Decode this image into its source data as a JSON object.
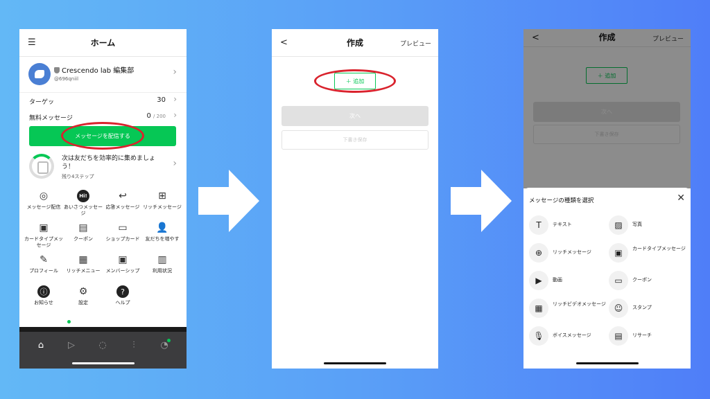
{
  "colors": {
    "line_green": "#06c755",
    "highlight_red": "#d9232d",
    "background_left": "#63b8f6",
    "background_right": "#4f7ef8"
  },
  "screen1": {
    "menu_icon": "☰",
    "title": "ホーム",
    "account": {
      "name": "Crescendo lab 編集部",
      "id": "@696qniil"
    },
    "target": {
      "label": "ターゲッ",
      "value": "30"
    },
    "free_messages": {
      "label": "無料メッセージ",
      "value": "0",
      "limit": "/ 200"
    },
    "send_button": "メッセージを配信する",
    "steps": {
      "text": "次は友だちを効率的に集めましょう！",
      "sub": "残り4ステップ"
    },
    "grid": [
      {
        "label": "メッセージ配信",
        "icon": "broadcast-icon",
        "glyph": "◎"
      },
      {
        "label": "あいさつメッセージ",
        "icon": "hi-bubble-icon",
        "glyph": "Hi!"
      },
      {
        "label": "応答メッセージ",
        "icon": "reply-icon",
        "glyph": "↩"
      },
      {
        "label": "リッチメッセージ",
        "icon": "rich-message-icon",
        "glyph": "⊞"
      },
      {
        "label": "カードタイプメッセージ",
        "icon": "card-type-icon",
        "glyph": "▣"
      },
      {
        "label": "クーポン",
        "icon": "coupon-icon",
        "glyph": "▤"
      },
      {
        "label": "ショップカード",
        "icon": "shop-card-icon",
        "glyph": "▭"
      },
      {
        "label": "友だちを増やす",
        "icon": "add-friend-icon",
        "glyph": "👤"
      },
      {
        "label": "プロフィール",
        "icon": "profile-icon",
        "glyph": "✎"
      },
      {
        "label": "リッチメニュー",
        "icon": "rich-menu-icon",
        "glyph": "▦"
      },
      {
        "label": "メンバーシップ",
        "icon": "membership-icon",
        "glyph": "▣"
      },
      {
        "label": "利用状況",
        "icon": "usage-icon",
        "glyph": "▥"
      },
      {
        "label": "お知らせ",
        "icon": "notice-icon",
        "glyph": "ⓘ"
      },
      {
        "label": "設定",
        "icon": "settings-icon",
        "glyph": "⚙"
      },
      {
        "label": "ヘルプ",
        "icon": "help-icon",
        "glyph": "?"
      }
    ],
    "tabs": [
      {
        "icon": "home-tab-icon",
        "glyph": "⌂"
      },
      {
        "icon": "play-tab-icon",
        "glyph": "▷"
      },
      {
        "icon": "chat-tab-icon",
        "glyph": "◌"
      },
      {
        "icon": "stats-tab-icon",
        "glyph": "⫶"
      },
      {
        "icon": "bell-tab-icon",
        "glyph": "◔"
      }
    ]
  },
  "screen2": {
    "back": "<",
    "title": "作成",
    "preview": "プレビュー",
    "add_button": "＋ 追加",
    "next_button": "次へ",
    "draft_button": "下書き保存"
  },
  "screen3": {
    "back": "<",
    "title": "作成",
    "preview": "プレビュー",
    "add_button": "＋ 追加",
    "next_button": "次へ",
    "draft_button": "下書き保存",
    "sheet_title": "メッセージの種類を選択",
    "close": "✕",
    "options": [
      {
        "label": "テキスト",
        "icon": "text-icon",
        "glyph": "T"
      },
      {
        "label": "写真",
        "icon": "photo-icon",
        "glyph": "▨"
      },
      {
        "label": "リッチメッセージ",
        "icon": "rich-message-icon",
        "glyph": "⊕"
      },
      {
        "label": "カードタイプメッセージ",
        "icon": "card-type-icon",
        "glyph": "▣"
      },
      {
        "label": "動画",
        "icon": "video-icon",
        "glyph": "▶"
      },
      {
        "label": "クーポン",
        "icon": "coupon-icon",
        "glyph": "▭"
      },
      {
        "label": "リッチビデオメッセージ",
        "icon": "rich-video-icon",
        "glyph": "▦"
      },
      {
        "label": "スタンプ",
        "icon": "sticker-icon",
        "glyph": "☺"
      },
      {
        "label": "ボイスメッセージ",
        "icon": "voice-icon",
        "glyph": "🎙"
      },
      {
        "label": "リサーチ",
        "icon": "research-icon",
        "glyph": "▤"
      }
    ]
  }
}
